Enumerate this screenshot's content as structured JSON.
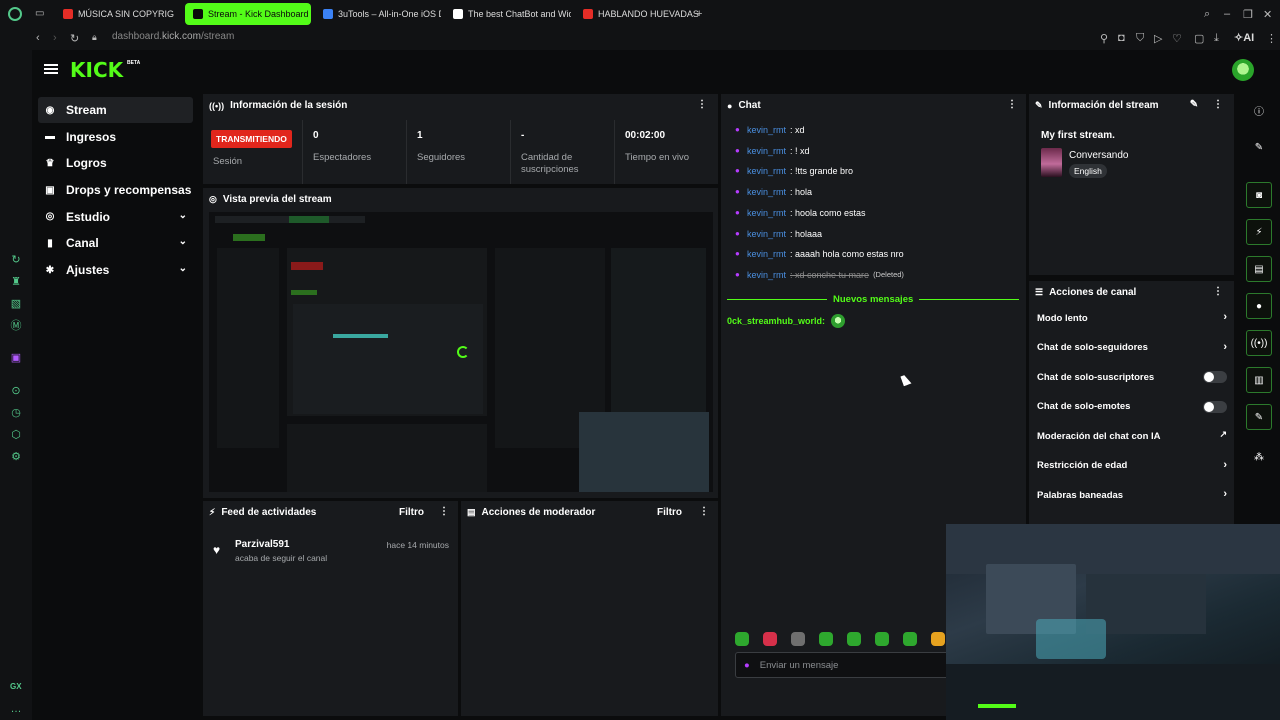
{
  "browser": {
    "tabs": [
      {
        "label": "MÚSICA SIN COPYRIG",
        "icon": "youtube-icon",
        "color": "#e52d27"
      },
      {
        "label": "Stream - Kick Dashboard",
        "icon": "kick-icon",
        "color": "#0a0a0a",
        "active": true
      },
      {
        "label": "3uTools – All-in-One iOS D",
        "icon": "3utools-icon",
        "color": "#3b82f6"
      },
      {
        "label": "The best ChatBot and Wid",
        "icon": "chatbot-icon",
        "color": "#ffffff"
      },
      {
        "label": "HABLANDO HUEVADAS - ",
        "icon": "youtube-icon",
        "color": "#e52d27"
      }
    ],
    "url_prefix": "dashboard.",
    "url_host": "kick.com",
    "url_path": "/stream",
    "ai_label": "AI"
  },
  "sidebar_rail_bottom": "GX",
  "header": {
    "logo": "KICK",
    "logo_badge": "BETA"
  },
  "nav": [
    {
      "label": "Stream",
      "icon": "stream-icon",
      "glyph": "◉",
      "active": true
    },
    {
      "label": "Ingresos",
      "icon": "revenue-icon",
      "glyph": "▬"
    },
    {
      "label": "Logros",
      "icon": "trophy-icon",
      "glyph": "♛"
    },
    {
      "label": "Drops y recompensas",
      "icon": "gift-icon",
      "glyph": "▣"
    },
    {
      "label": "Estudio",
      "icon": "studio-icon",
      "glyph": "◎",
      "expandable": true
    },
    {
      "label": "Canal",
      "icon": "channel-icon",
      "glyph": "▮",
      "expandable": true
    },
    {
      "label": "Ajustes",
      "icon": "settings-icon",
      "glyph": "✱",
      "expandable": true
    }
  ],
  "session": {
    "title": "Información de la sesión",
    "badge": "TRANSMITIENDO",
    "badge_label": "Sesión",
    "stats": [
      {
        "value": "0",
        "label": "Espectadores"
      },
      {
        "value": "1",
        "label": "Seguidores"
      },
      {
        "value": "-",
        "label": "Cantidad de suscripciones"
      },
      {
        "value": "00:02:00",
        "label": "Tiempo en vivo"
      }
    ]
  },
  "preview": {
    "title": "Vista previa del stream"
  },
  "feed": {
    "title": "Feed de actividades",
    "filter": "Filtro",
    "items": [
      {
        "user": "Parzival591",
        "action": "acaba de seguir el canal",
        "time": "hace 14 minutos"
      }
    ]
  },
  "mod_actions": {
    "title": "Acciones de moderador",
    "filter": "Filtro"
  },
  "chat": {
    "title": "Chat",
    "messages": [
      {
        "user": "kevin_rmt",
        "text": ": xd"
      },
      {
        "user": "kevin_rmt",
        "text": ": ! xd"
      },
      {
        "user": "kevin_rmt",
        "text": ": !tts grande bro"
      },
      {
        "user": "kevin_rmt",
        "text": ": hola"
      },
      {
        "user": "kevin_rmt",
        "text": ": hoola como estas"
      },
      {
        "user": "kevin_rmt",
        "text": ": holaaa"
      },
      {
        "user": "kevin_rmt",
        "text": ": aaaah hola como estas nro"
      },
      {
        "user": "kevin_rmt",
        "text": ": xd conche tu mare",
        "deleted": true,
        "deleted_label": "(Deleted)"
      }
    ],
    "new_messages_label": "Nuevos mensajes",
    "bot_user": "0ck_streamhub_world:",
    "input_placeholder": "Enviar un mensaje",
    "emote_colors": [
      "#2ea82e",
      "#d6304a",
      "#6f6f6f",
      "#2ea82e",
      "#2ea82e",
      "#2ea82e",
      "#2ea82e",
      "#e6a21f"
    ]
  },
  "stream_info": {
    "title": "Información del stream",
    "stream_title": "My first stream.",
    "category": "Conversando",
    "language": "English"
  },
  "channel_actions": {
    "title": "Acciones de canal",
    "rows": [
      {
        "label": "Modo lento",
        "control": "chevron"
      },
      {
        "label": "Chat de solo-seguidores",
        "control": "chevron"
      },
      {
        "label": "Chat de solo-suscriptores",
        "control": "toggle"
      },
      {
        "label": "Chat de solo-emotes",
        "control": "toggle"
      },
      {
        "label": "Moderación del chat con IA",
        "control": "external"
      },
      {
        "label": "Restricción de edad",
        "control": "chevron"
      },
      {
        "label": "Palabras baneadas",
        "control": "chevron"
      }
    ]
  },
  "colors": {
    "accent": "#53fc18",
    "live": "#e1261c",
    "username": "#4a8fe0",
    "panel": "#181a1d"
  }
}
